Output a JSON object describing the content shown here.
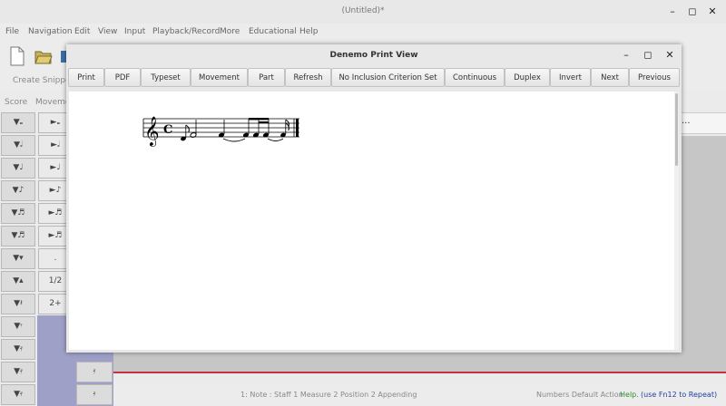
{
  "window": {
    "title": "(Untitled)*"
  },
  "menubar": {
    "items": [
      "File",
      "Navigation",
      "Edit",
      "View",
      "Input",
      "Playback/Record",
      "More",
      "Educational",
      "Help"
    ]
  },
  "toolbar": {
    "snippets_label": "Create Snippets"
  },
  "tabs": {
    "score": "Score",
    "movement": "Movemen"
  },
  "palette": {
    "right_col": [
      ".",
      "1/2",
      "2+"
    ]
  },
  "print_view": {
    "title": "Denemo Print View",
    "buttons": [
      "Print",
      "PDF",
      "Typeset",
      "Movement",
      "Part",
      "Refresh",
      "No Inclusion Criterion Set",
      "Continuous",
      "Duplex",
      "Invert",
      "Next",
      "Previous"
    ]
  },
  "score_header": {
    "text": "..."
  },
  "status": {
    "note_info": "1: Note : Staff 1 Measure 2 Position 2 Appending",
    "mode": "Numbers Default Action",
    "help_label": "Help.",
    "help_hint": "(use Fn12 to Repeat)",
    "help_color": "#2e8b2e",
    "hint_color": "#1f3f9f"
  }
}
